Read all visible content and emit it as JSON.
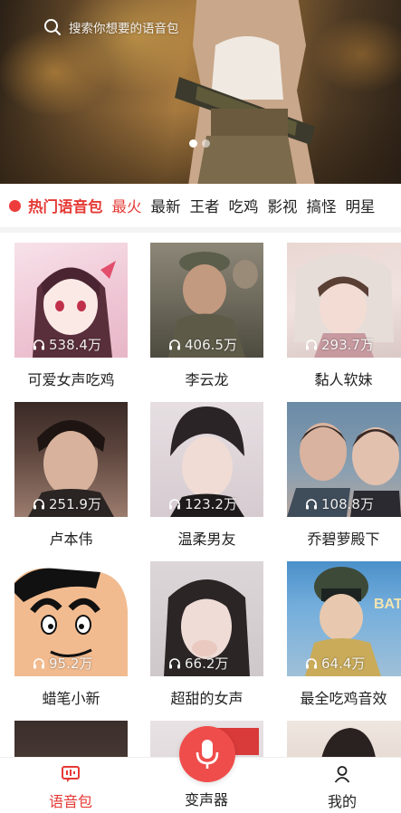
{
  "search": {
    "placeholder": "搜索你想要的语音包"
  },
  "banner": {
    "dots_total": 2,
    "active_dot": 0
  },
  "categories": {
    "hot_label": "热门语音包",
    "tabs": [
      "最火",
      "最新",
      "王者",
      "吃鸡",
      "影视",
      "搞怪",
      "明星"
    ],
    "active_index": 0
  },
  "packs": [
    {
      "title": "可爱女声吃鸡",
      "plays": "538.4万"
    },
    {
      "title": "李云龙",
      "plays": "406.5万"
    },
    {
      "title": "黏人软妹",
      "plays": "293.7万"
    },
    {
      "title": "卢本伟",
      "plays": "251.9万"
    },
    {
      "title": "温柔男友",
      "plays": "123.2万"
    },
    {
      "title": "乔碧萝殿下",
      "plays": "108.8万"
    },
    {
      "title": "蜡笔小新",
      "plays": "95.2万"
    },
    {
      "title": "超甜的女声",
      "plays": "66.2万"
    },
    {
      "title": "最全吃鸡音效",
      "plays": "64.4万"
    }
  ],
  "bottom_nav": {
    "items": [
      {
        "label": "语音包",
        "icon": "voice-pack-icon",
        "active": true
      },
      {
        "label": "变声器",
        "icon": "microphone-icon",
        "active": false
      },
      {
        "label": "我的",
        "icon": "person-icon",
        "active": false
      }
    ]
  },
  "colors": {
    "accent": "#e53935",
    "mic_button": "#ef4d4b"
  }
}
